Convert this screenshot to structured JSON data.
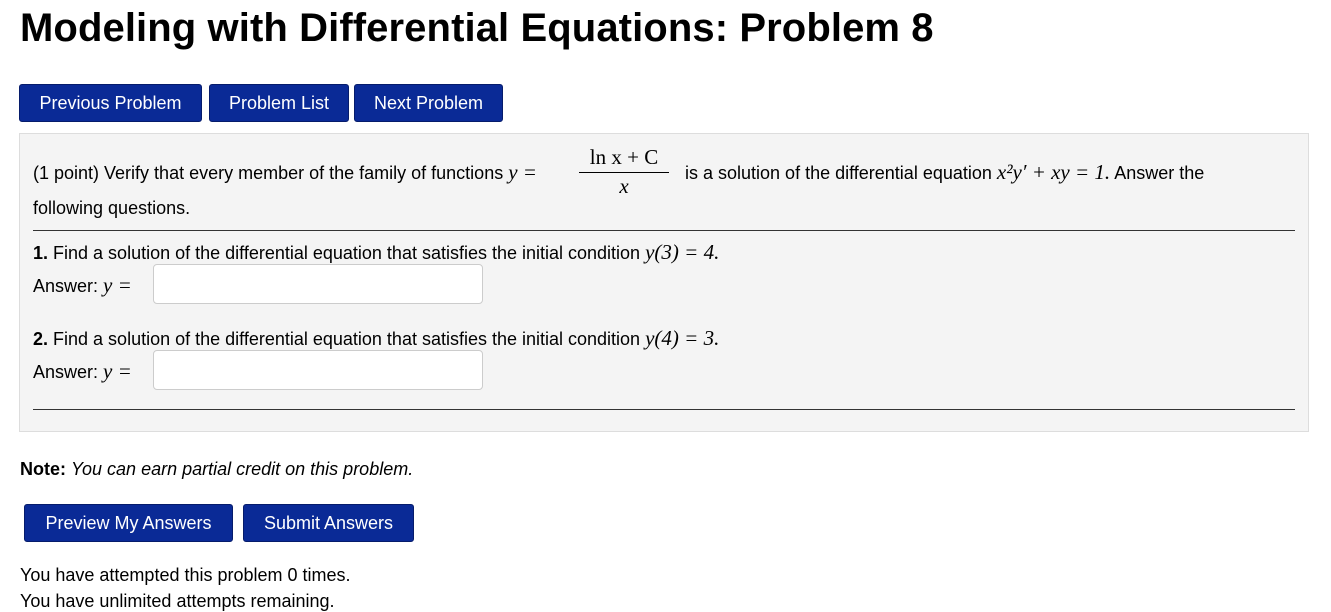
{
  "page": {
    "title": "Modeling with Differential Equations: Problem 8"
  },
  "nav": {
    "previous_label": "Previous Problem",
    "list_label": "Problem List",
    "next_label": "Next Problem"
  },
  "problem": {
    "intro_prefix": "(1 point) Verify that every member of the family of functions",
    "intro_y_eq": "y =",
    "frac_numerator": "ln x + C",
    "frac_denominator": "x",
    "intro_mid": "is a solution of the differential equation",
    "equation": "x²y′ + xy = 1.",
    "intro_suffix": "Answer the",
    "intro_line2": "following questions.",
    "questions": [
      {
        "number": "1.",
        "text": "Find a solution of the differential equation that satisfies the initial condition",
        "condition": "y(3) = 4.",
        "answer_label": "Answer:",
        "answer_var": "y =",
        "answer_value": ""
      },
      {
        "number": "2.",
        "text": "Find a solution of the differential equation that satisfies the initial condition",
        "condition": "y(4) = 3.",
        "answer_label": "Answer:",
        "answer_var": "y =",
        "answer_value": ""
      }
    ]
  },
  "note": {
    "label": "Note:",
    "text": "You can earn partial credit on this problem."
  },
  "actions": {
    "preview_label": "Preview My Answers",
    "submit_label": "Submit Answers"
  },
  "status": {
    "attempts": "You have attempted this problem 0 times.",
    "remaining": "You have unlimited attempts remaining."
  },
  "colors": {
    "button_bg": "#0a2a96",
    "panel_bg": "#f4f4f4"
  }
}
